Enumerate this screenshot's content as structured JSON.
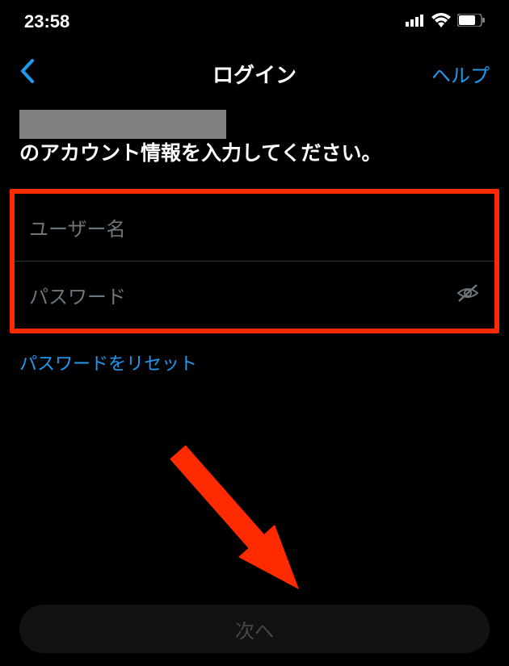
{
  "status": {
    "time": "23:58"
  },
  "header": {
    "title": "ログイン",
    "help": "ヘルプ"
  },
  "prompt": {
    "suffix": "のアカウント情報を入力してください。"
  },
  "form": {
    "username_placeholder": "ユーザー名",
    "password_placeholder": "パスワード"
  },
  "links": {
    "reset_password": "パスワードをリセット"
  },
  "buttons": {
    "next": "次へ"
  }
}
